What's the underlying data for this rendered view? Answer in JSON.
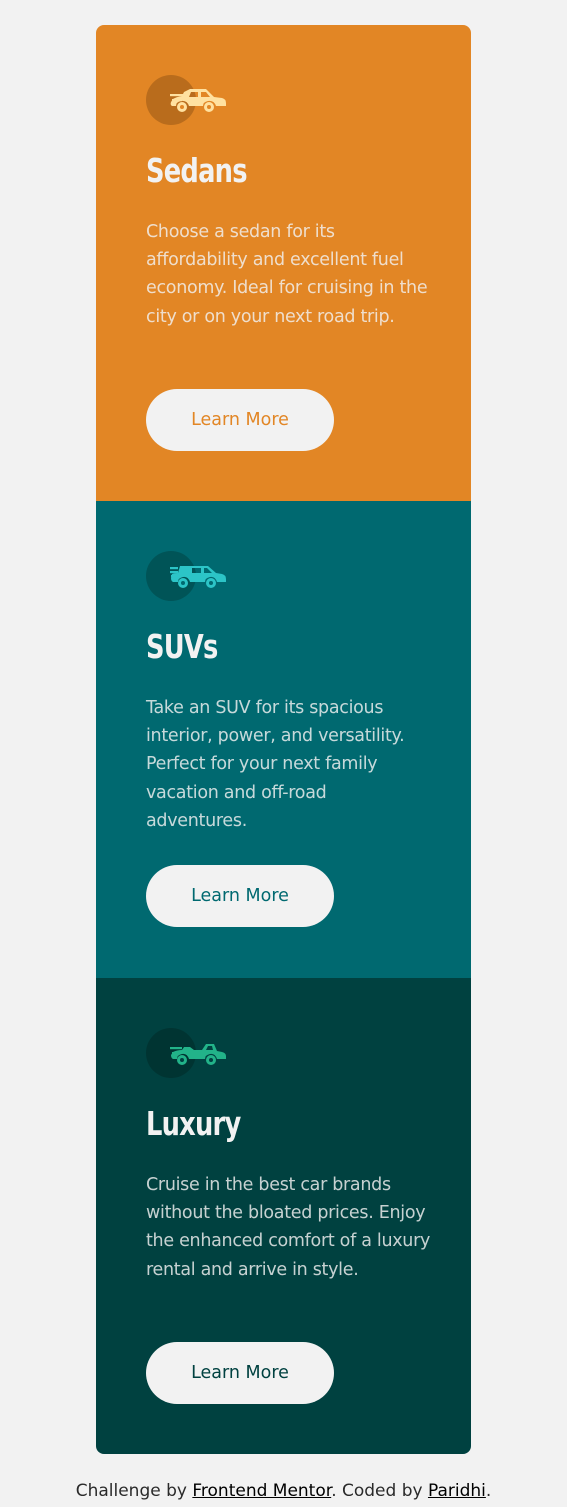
{
  "colors": {
    "page_bg": "#f2f2f2",
    "sedans_bg": "#e28625",
    "suvs_bg": "#006970",
    "luxury_bg": "#004140",
    "text_light": "#f2f2f2"
  },
  "cards": [
    {
      "icon": "sedan-car-icon",
      "title": "Sedans",
      "text": "Choose a sedan for its affordability and excellent fuel economy. Ideal for cruising in the city or on your next road trip.",
      "button": "Learn More"
    },
    {
      "icon": "suv-car-icon",
      "title": "SUVs",
      "text": "Take an SUV for its spacious interior, power, and versatility. Perfect for your next family vacation and off-road adventures.",
      "button": "Learn More"
    },
    {
      "icon": "luxury-car-icon",
      "title": "Luxury",
      "text": "Cruise in the best car brands without the bloated prices. Enjoy the enhanced comfort of a luxury rental and arrive in style.",
      "button": "Learn More"
    }
  ],
  "attribution": {
    "prefix": "Challenge by ",
    "link1": "Frontend Mentor",
    "middle": ". Coded by ",
    "link2": "Paridhi",
    "suffix": "."
  }
}
